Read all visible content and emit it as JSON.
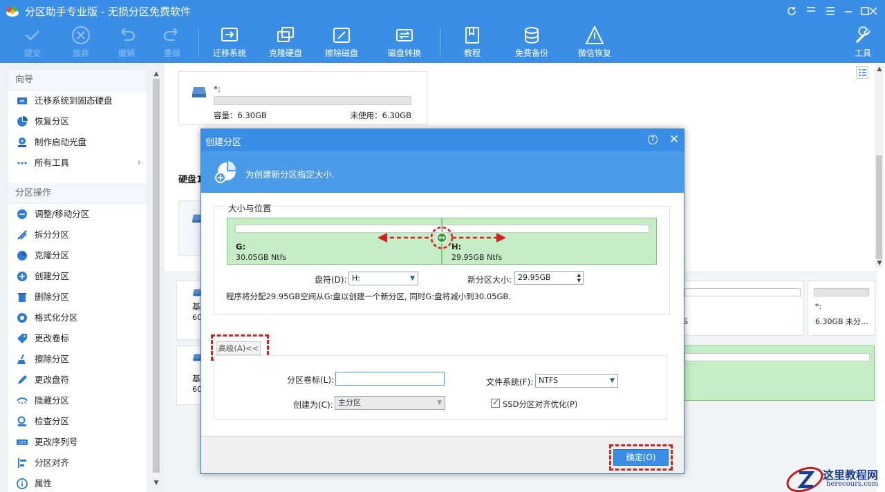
{
  "app": {
    "title": "分区助手专业版 - 无损分区免费软件",
    "window_controls": [
      "refresh",
      "minimize-to-tray",
      "menu",
      "minimize",
      "maximize",
      "close"
    ]
  },
  "toolbar": {
    "items": [
      {
        "label": "提交",
        "icon": "check-icon",
        "enabled": false
      },
      {
        "label": "放弃",
        "icon": "cancel-circle-icon",
        "enabled": false
      },
      {
        "label": "撤销",
        "icon": "undo-icon",
        "enabled": false
      },
      {
        "label": "重做",
        "icon": "redo-icon",
        "enabled": false
      },
      {
        "label": "迁移系统",
        "icon": "migrate-os-icon",
        "enabled": true
      },
      {
        "label": "克隆硬盘",
        "icon": "clone-disk-icon",
        "enabled": true
      },
      {
        "label": "擦除磁盘",
        "icon": "wipe-disk-icon",
        "enabled": true
      },
      {
        "label": "磁盘转换",
        "icon": "disk-convert-icon",
        "enabled": true
      },
      {
        "label": "教程",
        "icon": "book-icon",
        "enabled": true
      },
      {
        "label": "免费备份",
        "icon": "backup-icon",
        "enabled": true
      },
      {
        "label": "微信恢复",
        "icon": "recovery-icon",
        "enabled": true
      },
      {
        "label": "工具",
        "icon": "wrench-icon",
        "enabled": true
      }
    ]
  },
  "sidebar": {
    "wizard": {
      "heading": "向导",
      "items": [
        {
          "label": "迁移系统到固态硬盘",
          "icon": "migrate-ssd-icon"
        },
        {
          "label": "恢复分区",
          "icon": "recover-partition-icon"
        },
        {
          "label": "制作启动光盘",
          "icon": "boot-disc-icon"
        },
        {
          "label": "所有工具",
          "icon": "more-dots-icon",
          "chevron": "›"
        }
      ]
    },
    "operations": {
      "heading": "分区操作",
      "items": [
        {
          "label": "调整/移动分区",
          "icon": "resize-icon"
        },
        {
          "label": "拆分分区",
          "icon": "split-icon"
        },
        {
          "label": "克隆分区",
          "icon": "clone-partition-icon"
        },
        {
          "label": "创建分区",
          "icon": "create-partition-icon"
        },
        {
          "label": "删除分区",
          "icon": "trash-icon"
        },
        {
          "label": "格式化分区",
          "icon": "format-icon"
        },
        {
          "label": "更改卷标",
          "icon": "tag-icon"
        },
        {
          "label": "擦除分区",
          "icon": "broom-icon"
        },
        {
          "label": "更改盘符",
          "icon": "pencil-icon"
        },
        {
          "label": "隐藏分区",
          "icon": "hide-eye-icon"
        },
        {
          "label": "检查分区",
          "icon": "magnifier-icon"
        },
        {
          "label": "更改序列号",
          "icon": "serial-123-icon"
        },
        {
          "label": "分区对齐",
          "icon": "align-icon"
        },
        {
          "label": "属性",
          "icon": "info-icon"
        }
      ]
    }
  },
  "main": {
    "disk_card": {
      "label": "*:",
      "capacity": "容量：6.30GB",
      "unused": "未使用：6.30GB"
    },
    "disk_heading": "硬盘1",
    "bg_fragments": {
      "row1_a": "基",
      "row1_b": "60",
      "row2_a": "基",
      "row2_b": "60",
      "frag_s": "S",
      "right_label": "*:",
      "right_size": "6.30GB 未分..."
    }
  },
  "dialog": {
    "title": "创建分区",
    "help": "?",
    "close": "✕",
    "banner_text": "为创建新分区指定大小.",
    "section_label": "大小与位置",
    "partition_left": {
      "letter": "G:",
      "size": "30.05GB Ntfs"
    },
    "partition_right": {
      "letter": "H:",
      "size": "29.95GB Ntfs"
    },
    "split_fraction": 0.5,
    "drive_letter_label": "盘符(D):",
    "drive_letter_value": "H:",
    "new_size_label": "新分区大小:",
    "new_size_value": "29.95GB",
    "info": "程序将分配29.95GB空间从G:盘以创建一个新分区, 同时G:盘将减小到30.05GB.",
    "advanced_button": "高级(A)<<",
    "volume_label_label": "分区卷标(L):",
    "volume_label_value": "",
    "filesystem_label": "文件系统(F):",
    "filesystem_value": "NTFS",
    "create_as_label": "创建为(C):",
    "create_as_value": "主分区",
    "ssd_align_label": "SSD分区对齐优化(P)",
    "ssd_align_checked": true,
    "ok_button": "确定(O)"
  },
  "colors": {
    "accent": "#3a8ee6",
    "banner": "#4a9be8",
    "partition_fill": "#c6edc6",
    "highlight": "#d42020"
  },
  "watermark": {
    "title": "这里教程网",
    "url": "herecours.com"
  }
}
